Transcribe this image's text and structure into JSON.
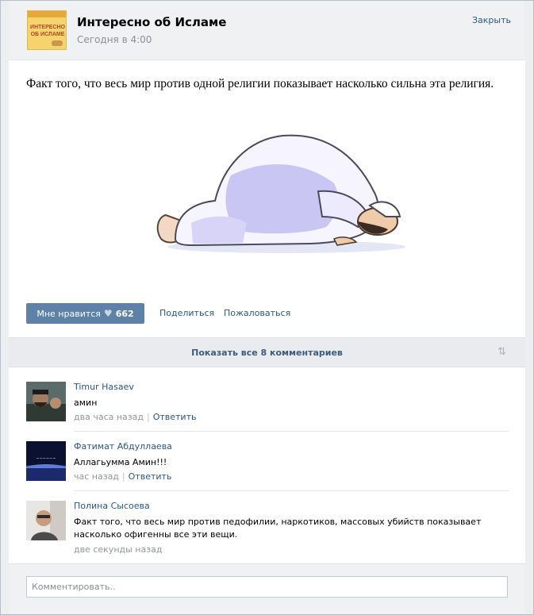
{
  "header": {
    "logo_text": [
      "ИНТЕРЕСНО",
      "ОБ ИСЛАМЕ"
    ],
    "title": "Интересно об Исламе",
    "timestamp": "Сегодня в 4:00",
    "close_label": "Закрыть"
  },
  "post": {
    "text": "Факт того, что весь мир против одной религии показывает насколько сильна эта религия.",
    "like_label": "Мне нравится",
    "like_count": "662",
    "share_label": "Поделиться",
    "report_label": "Пожаловаться"
  },
  "comments_bar": {
    "show_all_label": "Показать все 8 комментариев"
  },
  "comments": [
    {
      "author": "Timur Hasaev",
      "text": "амин",
      "time": "два часа назад",
      "reply_label": "Ответить"
    },
    {
      "author": "Фатимат Абдуллаева",
      "text": "Аллагьумма Амин!!!",
      "time": "час назад",
      "reply_label": "Ответить"
    },
    {
      "author": "Полина Сысоева",
      "text": "Факт того, что весь мир против педофилии, наркотиков, массовых убийств показывает насколько офигенны все эти вещи.",
      "time": "две секунды назад"
    }
  ],
  "comment_box": {
    "placeholder": "Комментировать.."
  },
  "colors": {
    "link": "#2a5885",
    "like_button": "#5e81a8",
    "header_bg": "#f0f1f3",
    "meta_gray": "#939699"
  }
}
